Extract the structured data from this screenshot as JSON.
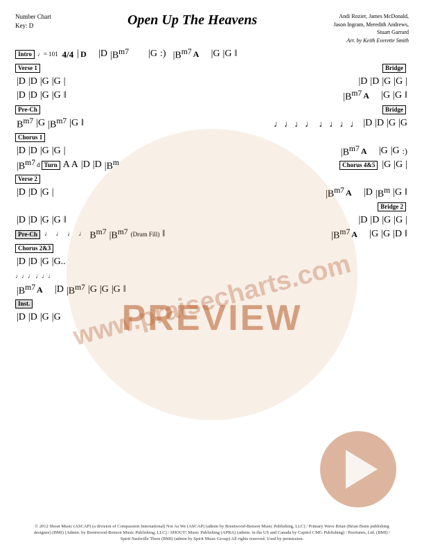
{
  "header": {
    "chart_type": "Number Chart",
    "key": "Key: D",
    "title": "Open Up The Heavens",
    "authors": "Andi Rozier, James McDonald,",
    "authors2": "Jason Ingram, Meredith Andrews,",
    "authors3": "Stuart Garrard",
    "arranger": "Arr. by Keith Everette Smith"
  },
  "sections": {
    "intro": "Intro",
    "verse1": "Verse 1",
    "bridge": "Bridge",
    "bridge2": "Bridge 2",
    "pre_chorus": "Pre-Ch",
    "chorus1": "Chorus 1",
    "chorus45": "Chorus 4&5",
    "chorus23": "Chorus 2&3",
    "verse2": "Verse 2",
    "turn": "Turn",
    "inst": "Inst.",
    "preview": "PREVIEW"
  },
  "watermark": "www.praisecharts.com",
  "footer": "© 2012 Shout Music (ASCAP) (a division of Compassion International) Not As We (ASCAP) (admin by Brentwood-Benson Music Publishing, LLC) / Primary Wave Brian (Brian Bunn publishing designee) (BMI) (Admin. by Brentwood-Benson Music Publishing, LLC) / SHOUT! Music Publishing (APRA) (admin. in the US and Canada by Capitol CMG Publishing) / Peertunes, Ltd. (BMI) / Spirit Nashville Three (BMI) (admin by Spirit Music Group) All rights reserved. Used by permission."
}
